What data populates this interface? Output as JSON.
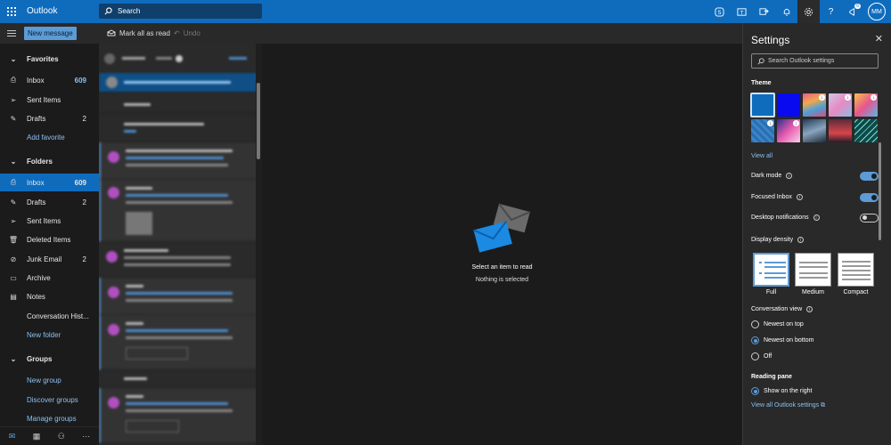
{
  "topbar": {
    "app_name": "Outlook",
    "search_placeholder": "Search",
    "avatar_initials": "MM",
    "notification_count": "6"
  },
  "cmdbar": {
    "new_message": "New message",
    "mark_all_read": "Mark all as read",
    "undo": "Undo"
  },
  "nav": {
    "favorites_header": "Favorites",
    "favorites": [
      {
        "label": "Inbox",
        "count": "609"
      },
      {
        "label": "Sent Items",
        "count": ""
      },
      {
        "label": "Drafts",
        "count": "2"
      }
    ],
    "add_favorite": "Add favorite",
    "folders_header": "Folders",
    "folders": [
      {
        "label": "Inbox",
        "count": "609"
      },
      {
        "label": "Drafts",
        "count": "2"
      },
      {
        "label": "Sent Items",
        "count": ""
      },
      {
        "label": "Deleted Items",
        "count": ""
      },
      {
        "label": "Junk Email",
        "count": "2"
      },
      {
        "label": "Archive",
        "count": ""
      },
      {
        "label": "Notes",
        "count": ""
      },
      {
        "label": "Conversation Hist...",
        "count": ""
      }
    ],
    "new_folder": "New folder",
    "groups_header": "Groups",
    "new_group": "New group",
    "discover_groups": "Discover groups",
    "manage_groups": "Manage groups"
  },
  "reading_pane": {
    "empty_title": "Select an item to read",
    "empty_subtitle": "Nothing is selected"
  },
  "settings": {
    "title": "Settings",
    "search_placeholder": "Search Outlook settings",
    "theme_label": "Theme",
    "view_all": "View all",
    "dark_mode": "Dark mode",
    "dark_mode_on": true,
    "focused_inbox": "Focused Inbox",
    "focused_inbox_on": true,
    "desktop_notifications": "Desktop notifications",
    "desktop_notifications_on": false,
    "display_density": "Display density",
    "density_options": [
      "Full",
      "Medium",
      "Compact"
    ],
    "density_selected": "Full",
    "conversation_view": "Conversation view",
    "conversation_options": [
      "Newest on top",
      "Newest on bottom",
      "Off"
    ],
    "conversation_selected": "Newest on bottom",
    "reading_pane": "Reading pane",
    "reading_pane_option": "Show on the right",
    "view_all_settings": "View all Outlook settings"
  },
  "colors": {
    "accent": "#0f6cbd",
    "link": "#8ac0f0",
    "toggle_on": "#5c9bd6"
  }
}
